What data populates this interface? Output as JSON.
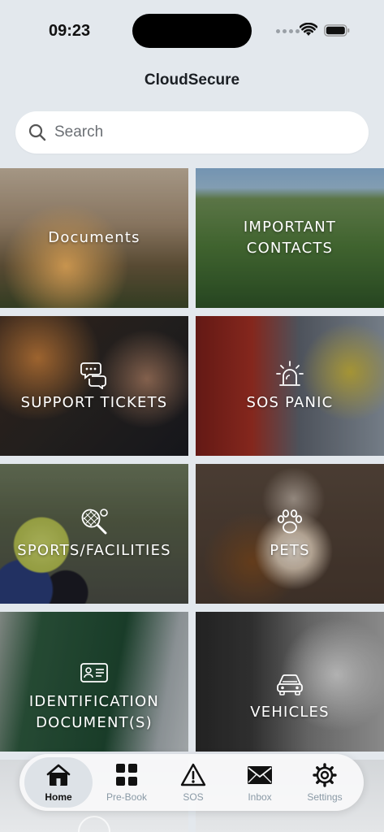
{
  "status_bar": {
    "time": "09:23"
  },
  "app": {
    "title": "CloudSecure"
  },
  "search": {
    "placeholder": "Search"
  },
  "tiles": [
    {
      "label": "Documents",
      "icon": "none"
    },
    {
      "label": "IMPORTANT\nCONTACTS",
      "icon": "none"
    },
    {
      "label": "SUPPORT TICKETS",
      "icon": "support-chat-icon"
    },
    {
      "label": "SOS PANIC",
      "icon": "alarm-siren-icon"
    },
    {
      "label": "SPORTS/FACILITIES",
      "icon": "tennis-racket-icon"
    },
    {
      "label": "PETS",
      "icon": "paw-icon"
    },
    {
      "label": "IDENTIFICATION\nDOCUMENT(S)",
      "icon": "id-card-icon"
    },
    {
      "label": "VEHICLES",
      "icon": "car-icon"
    }
  ],
  "tab_bar": {
    "items": [
      {
        "label": "Home",
        "icon": "home-icon",
        "active": true
      },
      {
        "label": "Pre-Book",
        "icon": "grid-icon",
        "active": false
      },
      {
        "label": "SOS",
        "icon": "warning-triangle-icon",
        "active": false
      },
      {
        "label": "Inbox",
        "icon": "envelope-icon",
        "active": false
      },
      {
        "label": "Settings",
        "icon": "gear-icon",
        "active": false
      }
    ]
  },
  "colors": {
    "background": "#e3e8ed",
    "tab_active_bg": "#dde2e7",
    "tab_inactive_text": "#8a9aa6",
    "text_dark": "#111111"
  }
}
